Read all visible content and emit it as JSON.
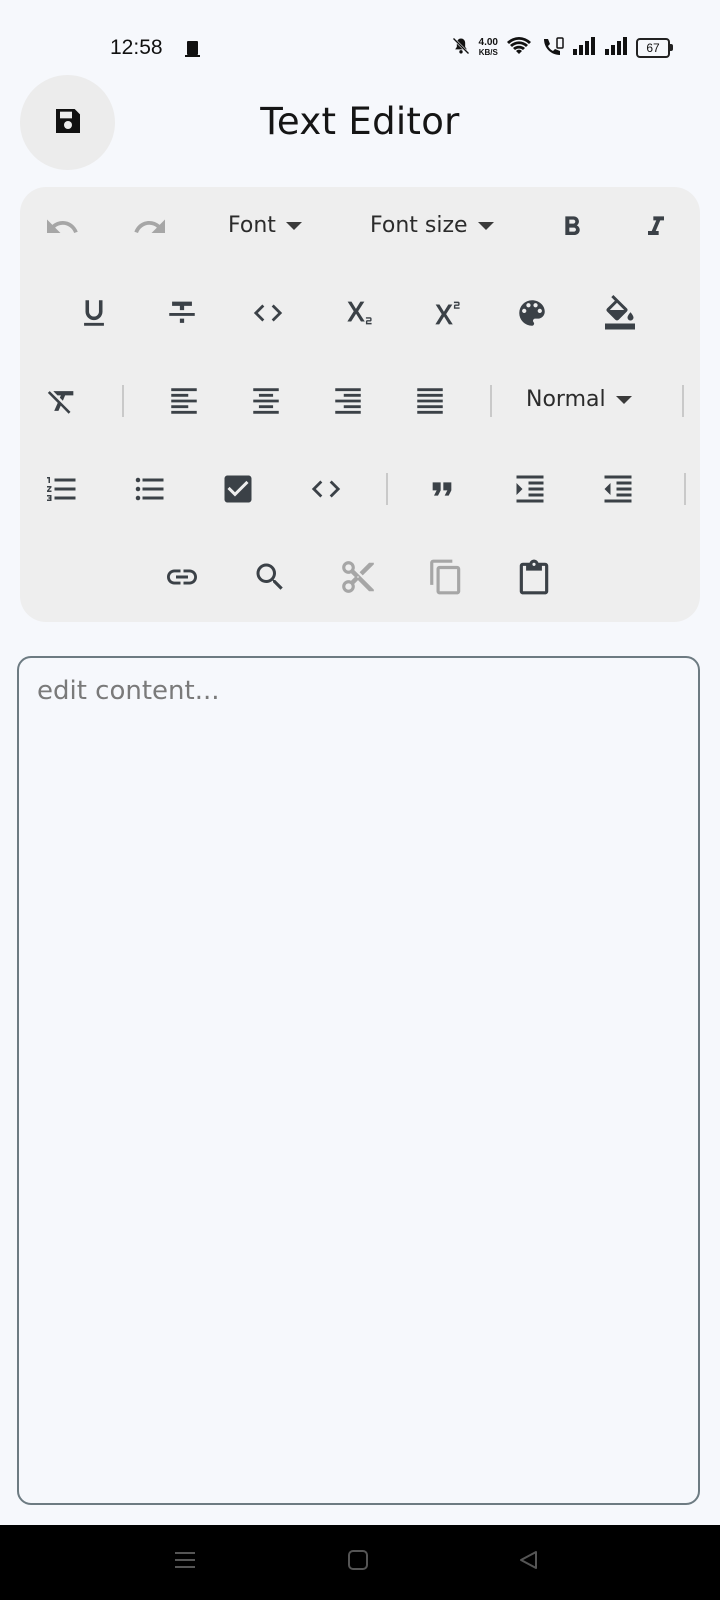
{
  "status_bar": {
    "time": "12:58",
    "speed_value": "4.00",
    "speed_unit": "KB/S",
    "battery": "67"
  },
  "header": {
    "title": "Text Editor",
    "save_icon": "floppy-disk-icon"
  },
  "toolbar": {
    "font_label": "Font",
    "font_size_label": "Font size",
    "style_label": "Normal",
    "icons": [
      "undo-icon",
      "redo-icon",
      "bold-icon",
      "italic-icon",
      "underline-icon",
      "strikethrough-icon",
      "inline-code-icon",
      "subscript-icon",
      "superscript-icon",
      "text-color-palette-icon",
      "background-color-fill-icon",
      "clear-format-icon",
      "align-left-icon",
      "align-center-icon",
      "align-right-icon",
      "align-justify-icon",
      "numbered-list-icon",
      "bullet-list-icon",
      "checkbox-list-icon",
      "code-block-icon",
      "quote-icon",
      "indent-increase-icon",
      "indent-decrease-icon",
      "link-icon",
      "search-icon",
      "cut-icon",
      "copy-icon",
      "paste-icon"
    ]
  },
  "editor": {
    "placeholder": "edit content..."
  },
  "colors": {
    "background": "#f6f8fc",
    "toolbar_bg": "#eeeeee",
    "icon_active": "#3b4147",
    "icon_disabled": "#a6a6a6",
    "editor_border": "#6d7b82"
  }
}
